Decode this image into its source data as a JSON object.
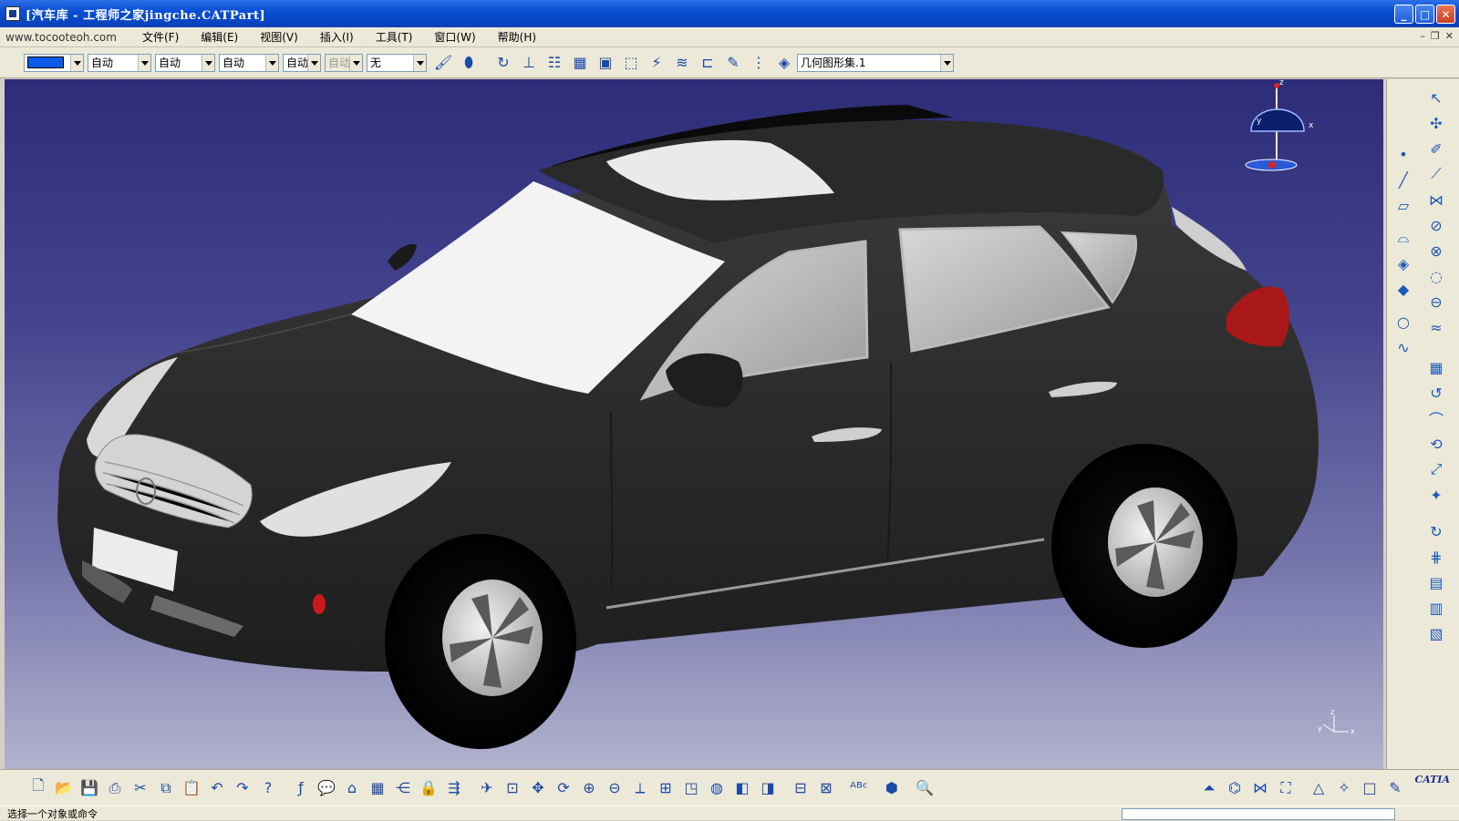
{
  "window": {
    "title": "[汽车库 - 工程师之家jingche.CATPart]"
  },
  "menu": {
    "watermark": "www.tocooteoh.com",
    "items": [
      "文件(F)",
      "编辑(E)",
      "视图(V)",
      "插入(I)",
      "工具(T)",
      "窗口(W)",
      "帮助(H)"
    ]
  },
  "properties_toolbar": {
    "color": "#0a5ce8",
    "linetype": "自动",
    "thickness": "自动",
    "point_symbol": "自动",
    "layer": "自动",
    "disabled_combo": "自动",
    "layer_filter": "无",
    "geometric_set": "几何图形集.1"
  },
  "statusbar": {
    "message": "选择一个对象或命令"
  },
  "compass": {
    "x": "x",
    "y": "y",
    "z": "z"
  },
  "branding": {
    "logo_text": "CATIA"
  }
}
